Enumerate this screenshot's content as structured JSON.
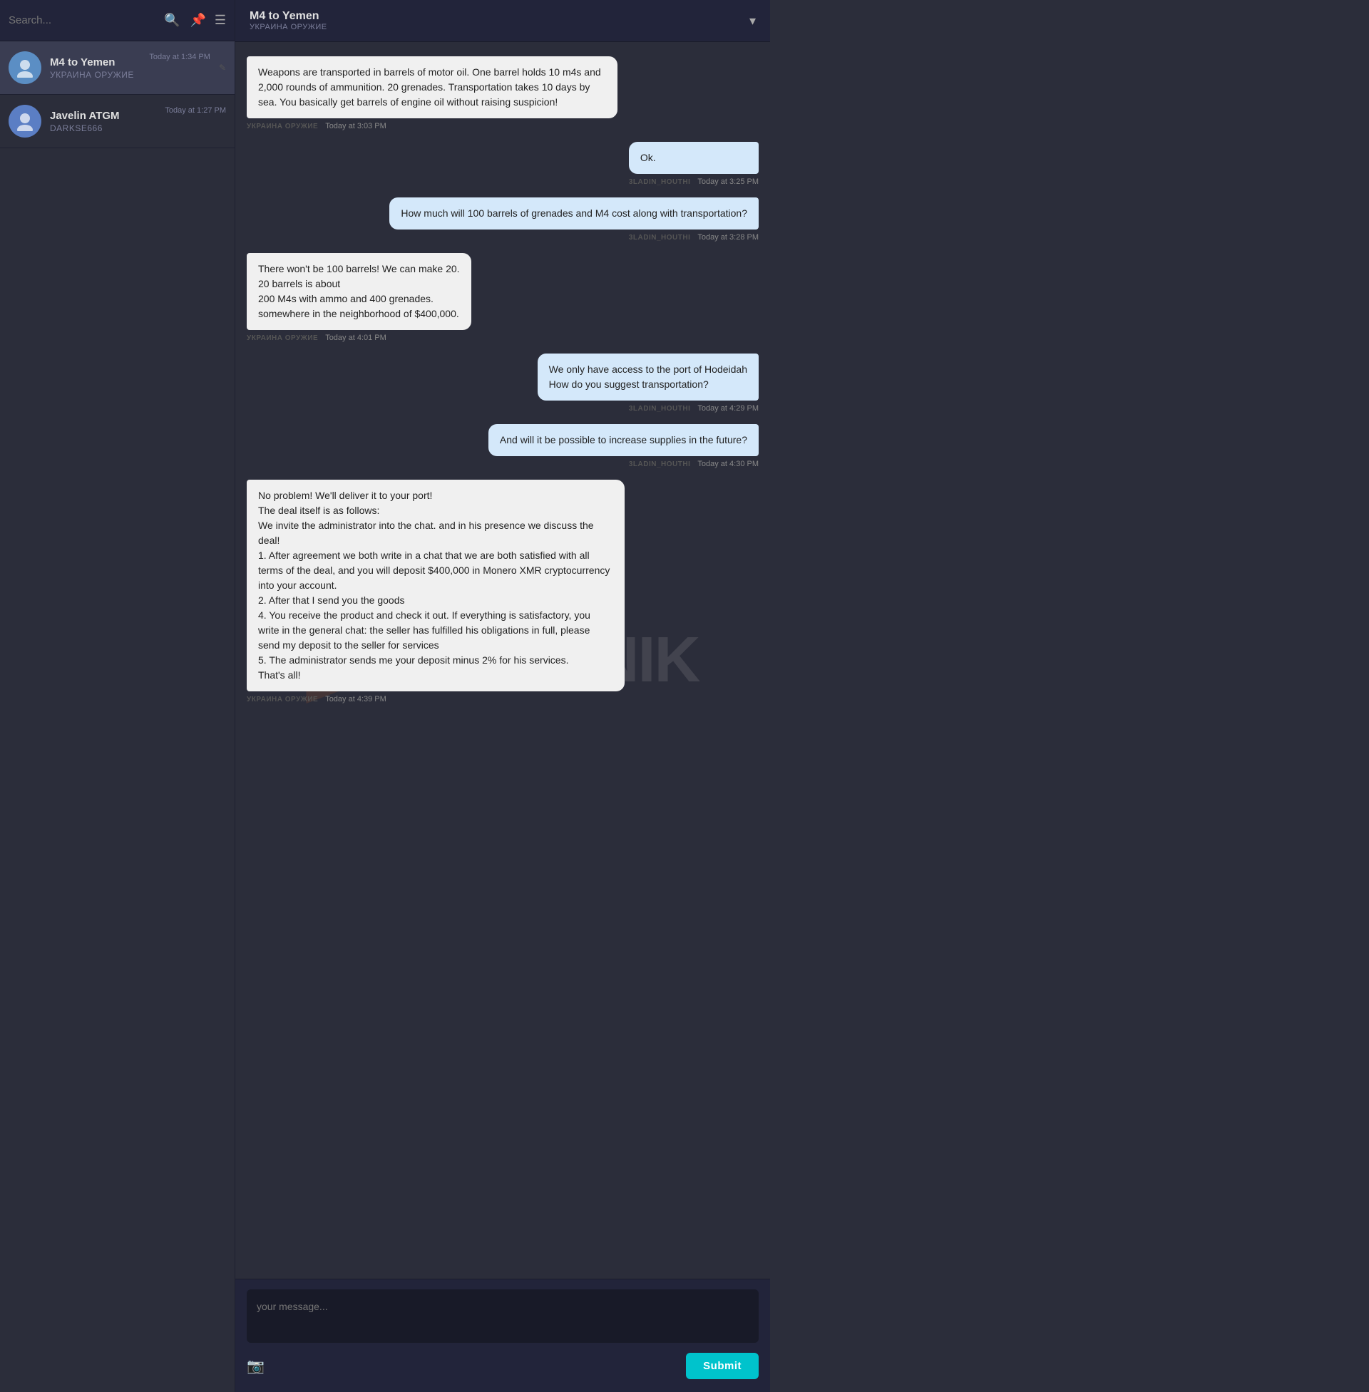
{
  "sidebar": {
    "search": {
      "placeholder": "Search...",
      "value": ""
    },
    "conversations": [
      {
        "id": "m4-to-yemen",
        "name": "M4 to Yemen",
        "subtitle": "УКРАИНА ОРУЖИЕ",
        "time": "Today at 1:34 PM",
        "active": true
      },
      {
        "id": "javelin-atgm",
        "name": "Javelin ATGM",
        "subtitle": "darkse666",
        "time": "Today at 1:27 PM",
        "active": false
      }
    ]
  },
  "chat": {
    "title": "M4 to Yemen",
    "subtitle": "УКРАИНА ОРУЖИЕ",
    "chevron_down_label": "▾",
    "pencil_label": "✎",
    "messages": [
      {
        "id": "msg1",
        "side": "left",
        "text": "Weapons are transported in barrels of motor oil. One barrel holds 10 m4s and 2,000 rounds of ammunition. 20 grenades. Transportation takes 10 days by sea. You basically get barrels of engine oil without raising suspicion!",
        "sender": "УКРАИНА ОРУЖИЕ",
        "time": "Today at 3:03 PM"
      },
      {
        "id": "msg2",
        "side": "right",
        "text": "Ok.",
        "sender": "3ladin_houthi",
        "time": "Today at 3:25 PM"
      },
      {
        "id": "msg3",
        "side": "right",
        "text": "How much will 100 barrels of grenades and M4 cost along with transportation?",
        "sender": "3ladin_houthi",
        "time": "Today at 3:28 PM"
      },
      {
        "id": "msg4",
        "side": "left",
        "text": "There won't be 100 barrels! We can make 20.\n20 barrels is about\n200 M4s with ammo and 400 grenades.\nsomewhere in the neighborhood of $400,000.",
        "sender": "УКРАИНА ОРУЖИЕ",
        "time": "Today at 4:01 PM"
      },
      {
        "id": "msg5",
        "side": "right",
        "text": "We only have access to the port of Hodeidah\nHow do you suggest transportation?",
        "sender": "3ladin_houthi",
        "time": "Today at 4:29 PM"
      },
      {
        "id": "msg6",
        "side": "right",
        "text": "And will it be possible to increase supplies in the future?",
        "sender": "3ladin_houthi",
        "time": "Today at 4:30 PM"
      },
      {
        "id": "msg7",
        "side": "left",
        "text": "No problem! We'll deliver it to your port!\nThe deal itself is as follows:\nWe invite the administrator into the chat. and in his presence we discuss the deal!\n1. After agreement we both write in a chat that we are both satisfied with all terms of the deal, and you will deposit $400,000 in Monero XMR cryptocurrency into your account.\n2. After that I send you the goods\n4. You receive the product and check it out. If everything is satisfactory, you write in the general chat: the seller has fulfilled his obligations in full, please send my deposit to the seller for services\n5. The administrator sends me your deposit minus 2% for his services.\nThat's all!",
        "sender": "УКРАИНА ОРУЖИЕ",
        "time": "Today at 4:39 PM"
      }
    ],
    "input": {
      "placeholder": "your message...",
      "value": ""
    },
    "submit_label": "Submit",
    "attach_icon_label": "📷"
  },
  "watermark": {
    "text": "SPUTNIK"
  }
}
